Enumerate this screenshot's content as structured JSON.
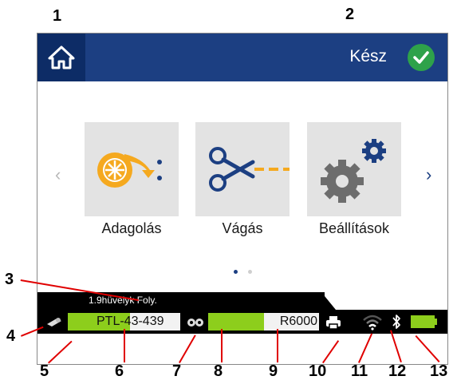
{
  "callouts": [
    "1",
    "2",
    "3",
    "4",
    "5",
    "6",
    "7",
    "8",
    "9",
    "10",
    "11",
    "12",
    "13"
  ],
  "header": {
    "status_text": "Kész"
  },
  "icons": {
    "home": "home-icon",
    "status": "checkmark-icon",
    "ribbon_small": "ribbon-cartridge-icon",
    "label_small": "label-cartridge-icon",
    "printer": "printer-icon",
    "wifi": "wifi-icon",
    "bluetooth": "bluetooth-icon",
    "battery": "battery-icon"
  },
  "menu": {
    "prev_arrow": "‹",
    "next_arrow": "›",
    "tiles": [
      {
        "label": "Adagolás",
        "icon": "feed-icon"
      },
      {
        "label": "Vágás",
        "icon": "scissors-icon"
      },
      {
        "label": "Beállítások",
        "icon": "settings-gears-icon"
      }
    ],
    "page_indicator": {
      "pages": 2,
      "current": 1
    }
  },
  "media": {
    "label": "1.9hüvelyk Foly."
  },
  "status": {
    "label_cartridge": {
      "name": "PTL-43-439",
      "remaining_fraction": 0.55
    },
    "ribbon": {
      "name": "R6000",
      "remaining_fraction": 0.5
    },
    "battery_level": 1.0
  },
  "colors": {
    "header_bg": "#1c3f82",
    "home_bg": "#0d2c66",
    "accent_green": "#8dce1c",
    "check_green": "#2ea24a",
    "callout_line": "#e00000",
    "icon_orange": "#f5a91f",
    "icon_blue": "#1c3f82"
  }
}
